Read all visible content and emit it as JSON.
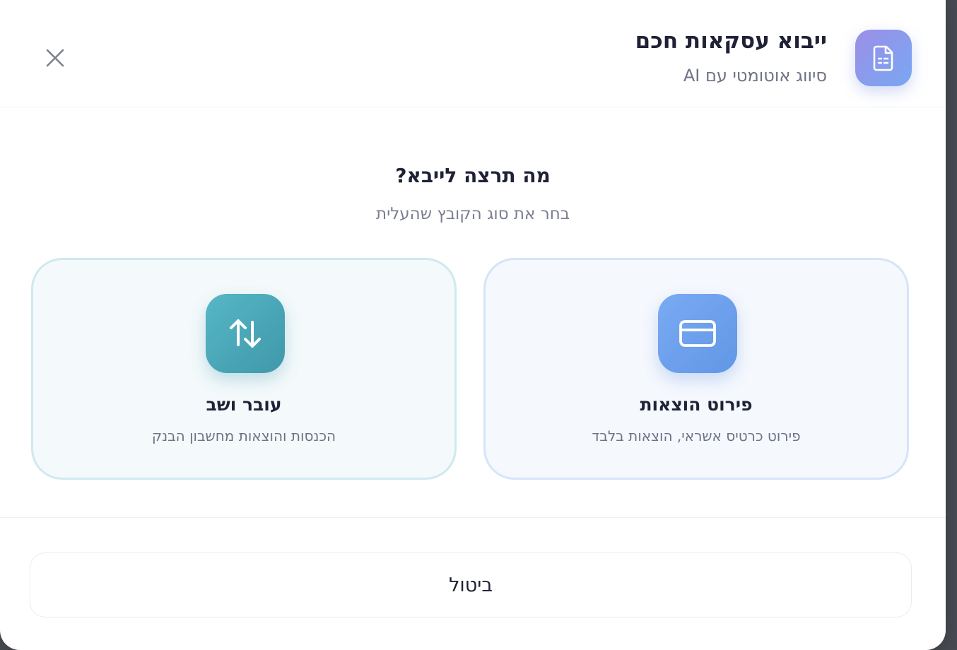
{
  "header": {
    "title": "ייבוא עסקאות חכם",
    "subtitle": "סיווג אוטומטי עם AI",
    "icon": "document-icon",
    "icon_gradient": [
      "#9b8fe6",
      "#79a7f3"
    ],
    "close_icon": "close-icon"
  },
  "prompt": {
    "question": "מה תרצה לייבא?",
    "hint": "בחר את סוג הקובץ שהעלית"
  },
  "options": [
    {
      "id": "credit",
      "title": "פירוט הוצאות",
      "description": "פירוט כרטיס אשראי, הוצאות בלבד",
      "icon": "credit-card-icon",
      "accent": "#6f9fee"
    },
    {
      "id": "bank",
      "title": "עובר ושב",
      "description": "הכנסות והוצאות מחשבון הבנק",
      "icon": "arrows-up-down-icon",
      "accent": "#4aa9b9"
    }
  ],
  "footer": {
    "cancel_label": "ביטול"
  }
}
